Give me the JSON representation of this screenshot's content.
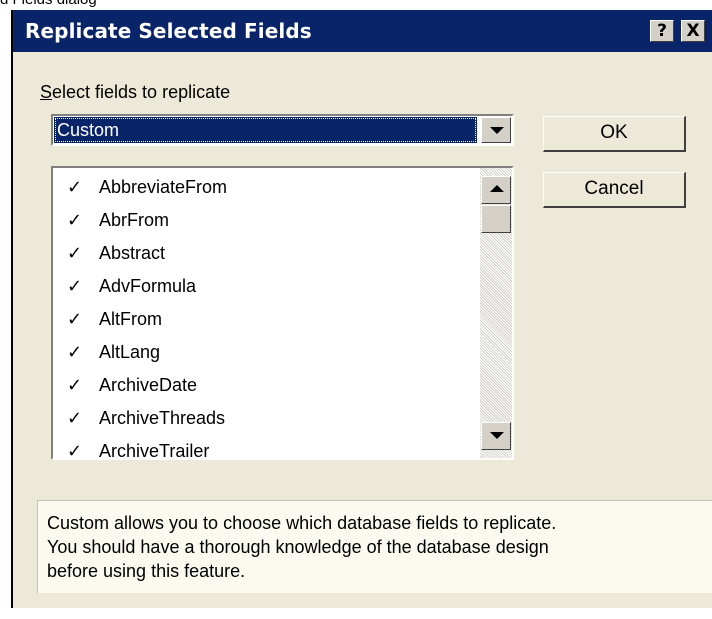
{
  "caption": "d Fields dialog",
  "window": {
    "title": "Replicate Selected Fields",
    "help_label": "?",
    "close_label": "X"
  },
  "select_label": {
    "underlined": "S",
    "rest": "elect fields to replicate"
  },
  "combo": {
    "value": "Custom"
  },
  "buttons": {
    "ok": "OK",
    "cancel": "Cancel"
  },
  "field_list": {
    "check_mark": "✓",
    "items": [
      {
        "label": "AbbreviateFrom",
        "checked": true
      },
      {
        "label": "AbrFrom",
        "checked": true
      },
      {
        "label": "Abstract",
        "checked": true
      },
      {
        "label": "AdvFormula",
        "checked": true
      },
      {
        "label": "AltFrom",
        "checked": true
      },
      {
        "label": "AltLang",
        "checked": true
      },
      {
        "label": "ArchiveDate",
        "checked": true
      },
      {
        "label": "ArchiveThreads",
        "checked": true
      },
      {
        "label": "ArchiveTrailer",
        "checked": true
      }
    ]
  },
  "info": {
    "lines": [
      "Custom allows you to choose which database fields to replicate.",
      "You should have a thorough knowledge of the database design",
      "before using this feature."
    ]
  },
  "colors": {
    "titlebar": "#0a246a",
    "dialog_bg": "#ece9d8",
    "selection": "#0a246a",
    "info_bg": "#fbfaf0"
  }
}
